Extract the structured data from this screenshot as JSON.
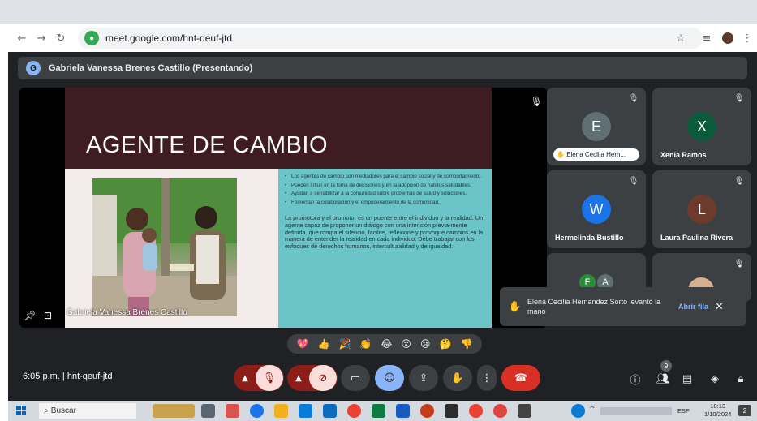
{
  "browser": {
    "url": "meet.google.com/hnt-qeuf-jtd",
    "back_icon": "arrow-left-icon",
    "forward_icon": "arrow-right-icon",
    "reload_icon": "reload-icon"
  },
  "meet": {
    "presenting_label": "Gabriela Vanessa Brenes Castillo (Presentando)",
    "presenter_overlay_name": "Gabriela Vanessa Brenes Castillo",
    "slide": {
      "title": "AGENTE DE CAMBIO",
      "bullets": [
        "Los agentes de cambio son mediadores para el cambio social y de comportamiento.",
        "Pueden influir en la toma de decisiones y en la adopción de hábitos saludables.",
        "Ayudan a sensibilizar a la comunidad sobre problemas de salud y soluciones.",
        "Fomentan la colaboración y el empoderamiento de la comunidad."
      ],
      "paragraph": "La promotora y el promotor es un puente entre el individuo y la realidad. Un agente capaz de proponer un diálogo con una intención previa-mente definida, que rompa el silencio, facilite, reflexione y provoque cambios en la manera de entender la realidad en cada individuo. Debe trabajar con los enfoques de derechos humanos, interculturalidad y de igualdad."
    },
    "participants": [
      {
        "initial": "E",
        "name": "Elena Cecilia Hern...",
        "color": "#5f6f73",
        "hand_raised": true
      },
      {
        "initial": "X",
        "name": "Xenia Ramos",
        "color": "#0b5a3b"
      },
      {
        "initial": "W",
        "name": "Hermelinda Bustillo",
        "color": "#1a73e8"
      },
      {
        "initial": "L",
        "name": "Laura Paulina Rivera",
        "color": "#6d3b2c"
      },
      {
        "initials": [
          "F",
          "A"
        ],
        "colors": [
          "#2e8b3b",
          "#5f6f73"
        ]
      },
      {
        "photo": true
      }
    ],
    "hand_toast": {
      "text": "Elena Cecilia Hernandez Sorto levantó la mano",
      "action": "Abrir fila"
    },
    "reactions": [
      "💖",
      "👍",
      "🎉",
      "👏",
      "😂",
      "😮",
      "😢",
      "🤔",
      "👎"
    ],
    "meeting_time_code": "6:05 p.m.  |  hnt-qeuf-jtd",
    "people_count": "9"
  },
  "taskbar": {
    "search_placeholder": "Buscar",
    "language": "ESP",
    "time": "18:13",
    "date": "1/10/2024",
    "notification_count": "2"
  }
}
